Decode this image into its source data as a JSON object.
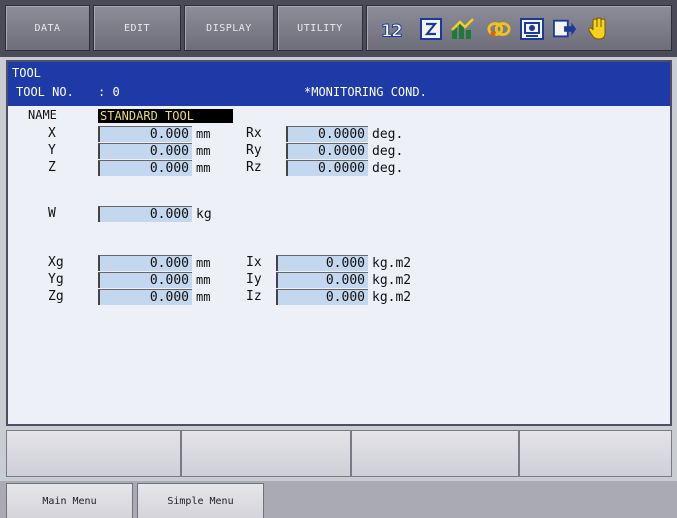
{
  "menu": {
    "data": "DATA",
    "edit": "EDIT",
    "display": "DISPLAY",
    "utility": "UTILITY"
  },
  "status_icons": [
    "numbers-icon",
    "edit-lock-icon",
    "chart-icon",
    "gear-link-icon",
    "display-icon",
    "export-icon",
    "hand-icon"
  ],
  "header": {
    "title": "TOOL",
    "tool_no_label": "TOOL NO.",
    "tool_no_value": ": 0",
    "mode": "*MONITORING COND."
  },
  "form": {
    "name_label": "NAME",
    "name_value": "STANDARD TOOL",
    "x_label": "X",
    "x_value": "0.000",
    "x_unit": "mm",
    "y_label": "Y",
    "y_value": "0.000",
    "y_unit": "mm",
    "z_label": "Z",
    "z_value": "0.000",
    "z_unit": "mm",
    "rx_label": "Rx",
    "rx_value": "0.0000",
    "rx_unit": "deg.",
    "ry_label": "Ry",
    "ry_value": "0.0000",
    "ry_unit": "deg.",
    "rz_label": "Rz",
    "rz_value": "0.0000",
    "rz_unit": "deg.",
    "w_label": "W",
    "w_value": "0.000",
    "w_unit": "kg",
    "xg_label": "Xg",
    "xg_value": "0.000",
    "xg_unit": "mm",
    "yg_label": "Yg",
    "yg_value": "0.000",
    "yg_unit": "mm",
    "zg_label": "Zg",
    "zg_value": "0.000",
    "zg_unit": "mm",
    "ix_label": "Ix",
    "ix_value": "0.000",
    "ix_unit": "kg.m2",
    "iy_label": "Iy",
    "iy_value": "0.000",
    "iy_unit": "kg.m2",
    "iz_label": "Iz",
    "iz_value": "0.000",
    "iz_unit": "kg.m2"
  },
  "bottom": {
    "main_menu": "Main Menu",
    "simple_menu": "Simple Menu"
  },
  "colors": {
    "header_bg": "#1d3aa6",
    "panel_bg": "#eef0f8",
    "field_bg": "#c3d7ef",
    "name_bg": "#000000",
    "name_fg": "#e9d97a",
    "menubar_bg": "#4a4a58"
  }
}
